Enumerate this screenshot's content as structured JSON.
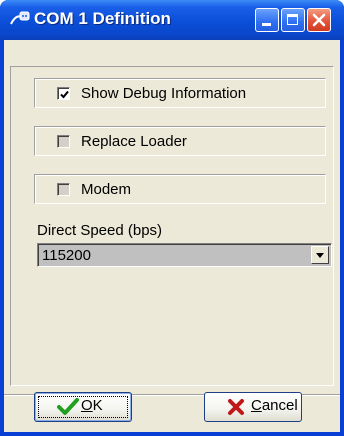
{
  "window": {
    "title": "COM 1 Definition",
    "app_icon": "serial-port-icon",
    "controls": [
      "minimize-icon",
      "maximize-icon",
      "close-icon"
    ]
  },
  "options": [
    {
      "label": "Show Debug Information",
      "checked": true,
      "enabled": true
    },
    {
      "label": "Replace Loader",
      "checked": false,
      "enabled": false
    },
    {
      "label": "Modem",
      "checked": false,
      "enabled": false
    }
  ],
  "direct_speed": {
    "label": "Direct Speed (bps)",
    "value": "115200"
  },
  "buttons": {
    "ok": {
      "mnemonic": "O",
      "rest": "K",
      "icon": "checkmark-icon"
    },
    "cancel": {
      "mnemonic": "C",
      "rest": "ancel",
      "icon": "x-icon"
    }
  },
  "colors": {
    "titlebar": "#0b4ed8",
    "close_button": "#e5533a",
    "dialog_bg": "#ece9d8",
    "ok_check": "#1fa01f",
    "cancel_x": "#c01818"
  }
}
